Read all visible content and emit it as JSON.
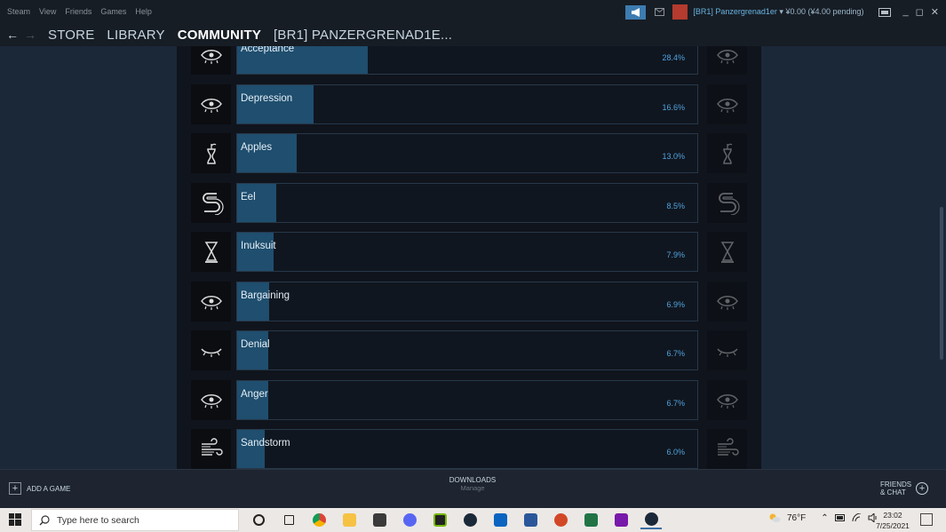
{
  "window": {
    "menu": [
      "Steam",
      "View",
      "Friends",
      "Games",
      "Help"
    ],
    "account_name": "[BR1] Panzergrenad1er",
    "account_balance": "▾ ¥0.00 (¥4.00 pending)",
    "controls": [
      "_",
      "◻",
      "✕"
    ]
  },
  "nav": {
    "back": "←",
    "forward": "→",
    "links": [
      "STORE",
      "LIBRARY",
      "COMMUNITY",
      "[BR1] PANZERGRENAD1E..."
    ],
    "active": "COMMUNITY"
  },
  "achievements": [
    {
      "name": "Acceptance",
      "percent": "28.4%",
      "fill": 28.4,
      "icon": "eye-icon"
    },
    {
      "name": "Depression",
      "percent": "16.6%",
      "fill": 16.6,
      "icon": "eye-icon"
    },
    {
      "name": "Apples",
      "percent": "13.0%",
      "fill": 13.0,
      "icon": "apple-core-icon"
    },
    {
      "name": "Eel",
      "percent": "8.5%",
      "fill": 8.5,
      "icon": "eel-icon"
    },
    {
      "name": "Inuksuit",
      "percent": "7.9%",
      "fill": 7.9,
      "icon": "inuksuk-icon"
    },
    {
      "name": "Bargaining",
      "percent": "6.9%",
      "fill": 6.9,
      "icon": "eye-icon"
    },
    {
      "name": "Denial",
      "percent": "6.7%",
      "fill": 6.7,
      "icon": "closed-eye-icon"
    },
    {
      "name": "Anger",
      "percent": "6.7%",
      "fill": 6.7,
      "icon": "eye-icon"
    },
    {
      "name": "Sandstorm",
      "percent": "6.0%",
      "fill": 6.0,
      "icon": "wind-icon"
    }
  ],
  "bottom": {
    "add_game": "ADD A GAME",
    "downloads": "DOWNLOADS",
    "downloads_sub": "Manage",
    "friends_line1": "FRIENDS",
    "friends_line2": "& CHAT"
  },
  "taskbar": {
    "search_placeholder": "Type here to search",
    "weather": "76°F",
    "time": "23:02",
    "date": "7/25/2021"
  },
  "colors": {
    "accent": "#4fa3e0",
    "bar_fill": "#1f4e6e",
    "background": "#1b2838"
  }
}
